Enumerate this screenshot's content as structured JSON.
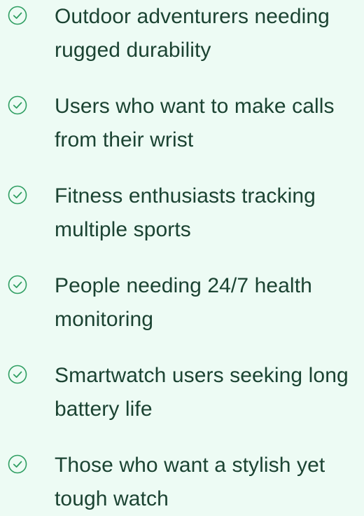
{
  "colors": {
    "background": "#edfbf4",
    "text": "#1b4332",
    "check": "#2f9e62"
  },
  "icon": "check-circle-icon",
  "items": [
    {
      "text": "Outdoor adventurers needing rugged durability"
    },
    {
      "text": "Users who want to make calls from their wrist"
    },
    {
      "text": "Fitness enthusiasts tracking multiple sports"
    },
    {
      "text": "People needing 24/7 health monitoring"
    },
    {
      "text": "Smartwatch users seeking long battery life"
    },
    {
      "text": "Those who want a stylish yet tough watch"
    }
  ]
}
